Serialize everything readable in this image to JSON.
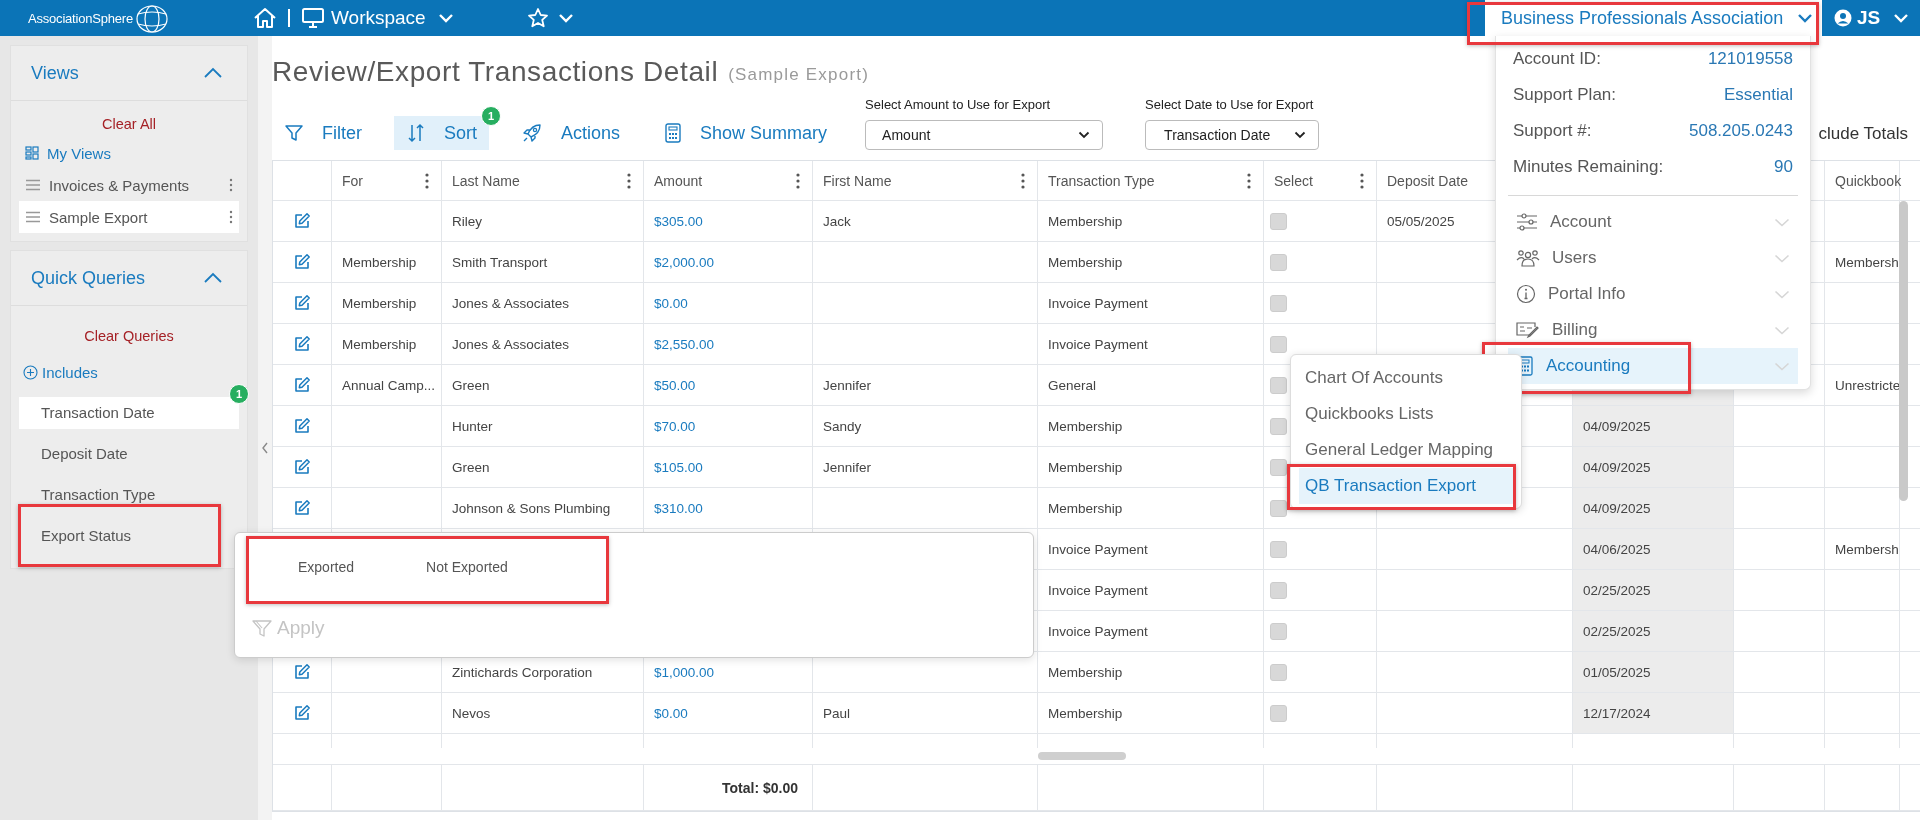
{
  "top_bar": {
    "logo": "AssociationSphere",
    "workspace": "Workspace",
    "organization": {
      "label": "Business Professionals Association",
      "expanded": true,
      "highlighted": true
    },
    "user": "JS"
  },
  "sidebar": {
    "views": {
      "title": "Views",
      "expanded": true,
      "clear": "Clear All",
      "items": [
        {
          "label": "My Views",
          "kind": "link",
          "selected": false
        },
        {
          "label": "Invoices & Payments",
          "kind": "view",
          "selected": false
        },
        {
          "label": "Sample Export",
          "kind": "view",
          "selected": true
        }
      ]
    },
    "quick_queries": {
      "title": "Quick Queries",
      "expanded": true,
      "clear": "Clear Queries",
      "includes": "Includes",
      "items": [
        {
          "label": "Transaction Date",
          "selected": true,
          "badge": "1",
          "highlighted": false
        },
        {
          "label": "Deposit Date",
          "selected": false,
          "highlighted": false
        },
        {
          "label": "Transaction Type",
          "selected": false,
          "highlighted": false
        },
        {
          "label": "Export Status",
          "selected": false,
          "highlighted": true
        }
      ]
    }
  },
  "page": {
    "title": "Review/Export Transactions Detail",
    "subtitle": "(Sample Export)"
  },
  "toolbar": {
    "buttons": [
      {
        "label": "Filter",
        "selected": false
      },
      {
        "label": "Sort",
        "selected": true,
        "badge": "1"
      },
      {
        "label": "Actions",
        "selected": false
      },
      {
        "label": "Show Summary",
        "selected": false
      }
    ],
    "selects": [
      {
        "label": "Select Amount to Use for Export",
        "value": "Amount"
      },
      {
        "label": "Select Date to Use for Export",
        "value": "Transaction Date"
      }
    ],
    "totals_label": "clude Totals"
  },
  "table": {
    "columns": [
      {
        "label": "For",
        "menu": true
      },
      {
        "label": "Last Name",
        "menu": true
      },
      {
        "label": "Amount",
        "menu": true
      },
      {
        "label": "First Name",
        "menu": true
      },
      {
        "label": "Transaction Type",
        "menu": true
      },
      {
        "label": "Select",
        "menu": true
      },
      {
        "label": "Deposit Date"
      },
      {
        "sorted": true
      },
      {
        "sorted": false
      },
      {
        "label": "Quickbook"
      }
    ],
    "rows": [
      {
        "editable": true,
        "checked": false,
        "last_name": "Riley",
        "amount": "$305.00",
        "first_name": "Jack",
        "transaction_type": "Membership",
        "deposit_date": "05/05/2025"
      },
      {
        "editable": true,
        "checked": false,
        "for": "Membership",
        "last_name": "Smith Transport",
        "amount": "$2,000.00",
        "transaction_type": "Membership",
        "quickbooks": "Membersh"
      },
      {
        "editable": true,
        "checked": false,
        "for": "Membership",
        "last_name": "Jones & Associates",
        "amount": "$0.00",
        "transaction_type": "Invoice Payment"
      },
      {
        "editable": true,
        "checked": false,
        "for": "Membership",
        "last_name": "Jones & Associates",
        "amount": "$2,550.00",
        "transaction_type": "Invoice Payment"
      },
      {
        "editable": true,
        "checked": false,
        "for": "Annual Camp...",
        "last_name": "Green",
        "amount": "$50.00",
        "first_name": "Jennifer",
        "transaction_type": "General",
        "quickbooks": "Unrestricte"
      },
      {
        "editable": true,
        "checked": false,
        "last_name": "Hunter",
        "amount": "$70.00",
        "first_name": "Sandy",
        "transaction_type": "Membership",
        "column_9": "04/09/2025"
      },
      {
        "editable": true,
        "checked": false,
        "last_name": "Green",
        "amount": "$105.00",
        "first_name": "Jennifer",
        "transaction_type": "Membership",
        "column_9": "04/09/2025"
      },
      {
        "editable": true,
        "checked": false,
        "last_name": "Johnson & Sons Plumbing",
        "amount": "$310.00",
        "transaction_type": "Membership",
        "column_9": "04/09/2025"
      },
      {
        "checked": false,
        "transaction_type": "Invoice Payment",
        "column_9": "04/06/2025",
        "quickbooks": "Membersh"
      },
      {
        "checked": false,
        "transaction_type": "Invoice Payment",
        "column_9": "02/25/2025"
      },
      {
        "checked": false,
        "transaction_type": "Invoice Payment",
        "column_9": "02/25/2025"
      },
      {
        "editable": true,
        "checked": false,
        "last_name": "Zintichards Corporation",
        "amount": "$1,000.00",
        "transaction_type": "Membership",
        "column_9": "01/05/2025"
      },
      {
        "editable": true,
        "checked": false,
        "last_name": "Nevos",
        "amount": "$0.00",
        "first_name": "Paul",
        "transaction_type": "Membership",
        "column_9": "12/17/2024"
      }
    ],
    "total": "Total: $0.00"
  },
  "export_status_popup": {
    "options_highlighted": true,
    "options": [
      {
        "label": "Exported",
        "selected": false
      },
      {
        "label": "Not Exported",
        "selected": false
      }
    ],
    "apply": {
      "label": "Apply",
      "disabled": true
    }
  },
  "account_menu": {
    "info": [
      {
        "label": "Account ID:",
        "value": "121019558"
      },
      {
        "label": "Support Plan:",
        "value": "Essential"
      },
      {
        "label": "Support #:",
        "value": "508.205.0243"
      },
      {
        "label": "Minutes Remaining:",
        "value": "90"
      }
    ],
    "items": [
      {
        "label": "Account",
        "selected": false,
        "highlighted": false
      },
      {
        "label": "Users",
        "selected": false,
        "highlighted": false
      },
      {
        "label": "Portal Info",
        "selected": false,
        "highlighted": false
      },
      {
        "label": "Billing",
        "selected": false,
        "highlighted": false
      },
      {
        "label": "Accounting",
        "selected": true,
        "highlighted": true
      }
    ]
  },
  "accounting_submenu": {
    "items": [
      {
        "label": "Chart Of Accounts",
        "selected": false,
        "highlighted": false
      },
      {
        "label": "Quickbooks Lists",
        "selected": false,
        "highlighted": false
      },
      {
        "label": "General Ledger Mapping",
        "selected": false,
        "highlighted": false
      },
      {
        "label": "QB Transaction Export",
        "selected": true,
        "highlighted": true
      }
    ]
  }
}
